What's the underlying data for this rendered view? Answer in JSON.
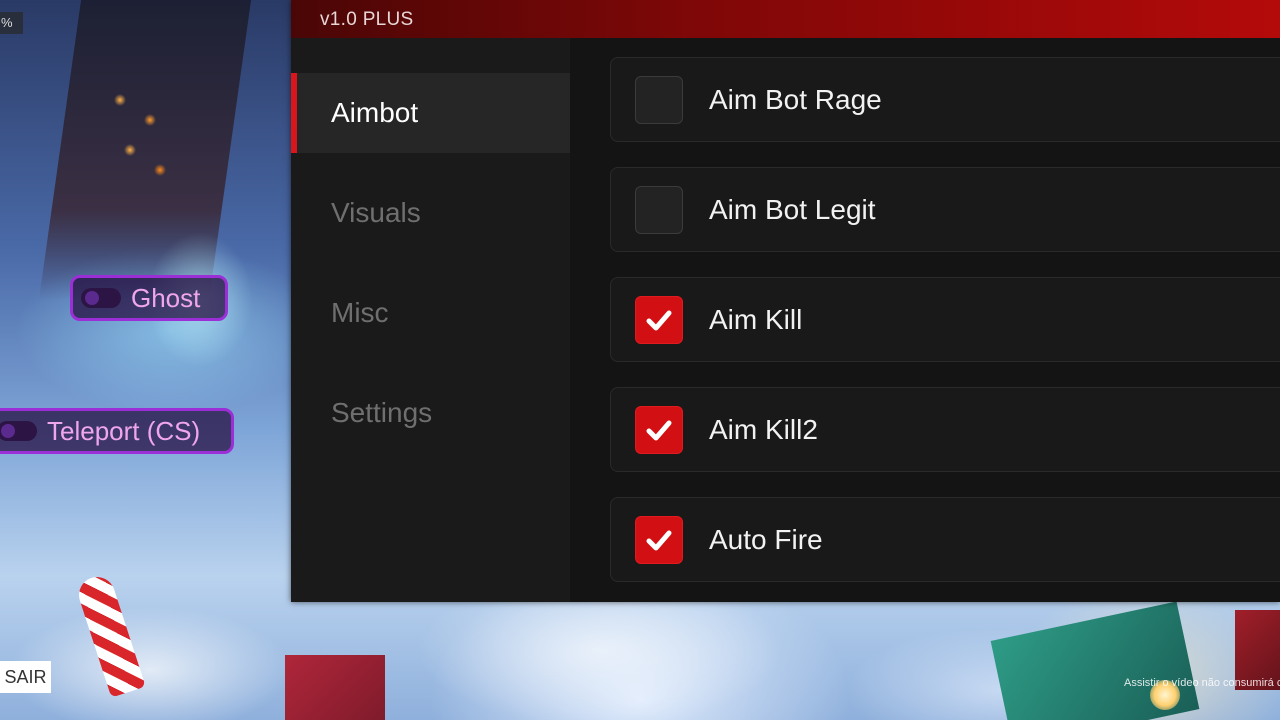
{
  "panel": {
    "version": "v1.0 PLUS",
    "nav": [
      {
        "label": "Aimbot",
        "active": true
      },
      {
        "label": "Visuals",
        "active": false
      },
      {
        "label": "Misc",
        "active": false
      },
      {
        "label": "Settings",
        "active": false
      }
    ],
    "options": [
      {
        "label": "Aim Bot Rage",
        "checked": false
      },
      {
        "label": "Aim Bot Legit",
        "checked": false
      },
      {
        "label": "Aim Kill",
        "checked": true
      },
      {
        "label": "Aim Kill2",
        "checked": true
      },
      {
        "label": "Auto Fire",
        "checked": true
      }
    ],
    "accent_color": "#d20f13"
  },
  "hud": {
    "corner_badge": "%",
    "ghost_label": "Ghost",
    "teleport_label": "Teleport (CS)",
    "sair_label": "SAIR",
    "notice": "Assistir o vídeo não consumirá c"
  }
}
